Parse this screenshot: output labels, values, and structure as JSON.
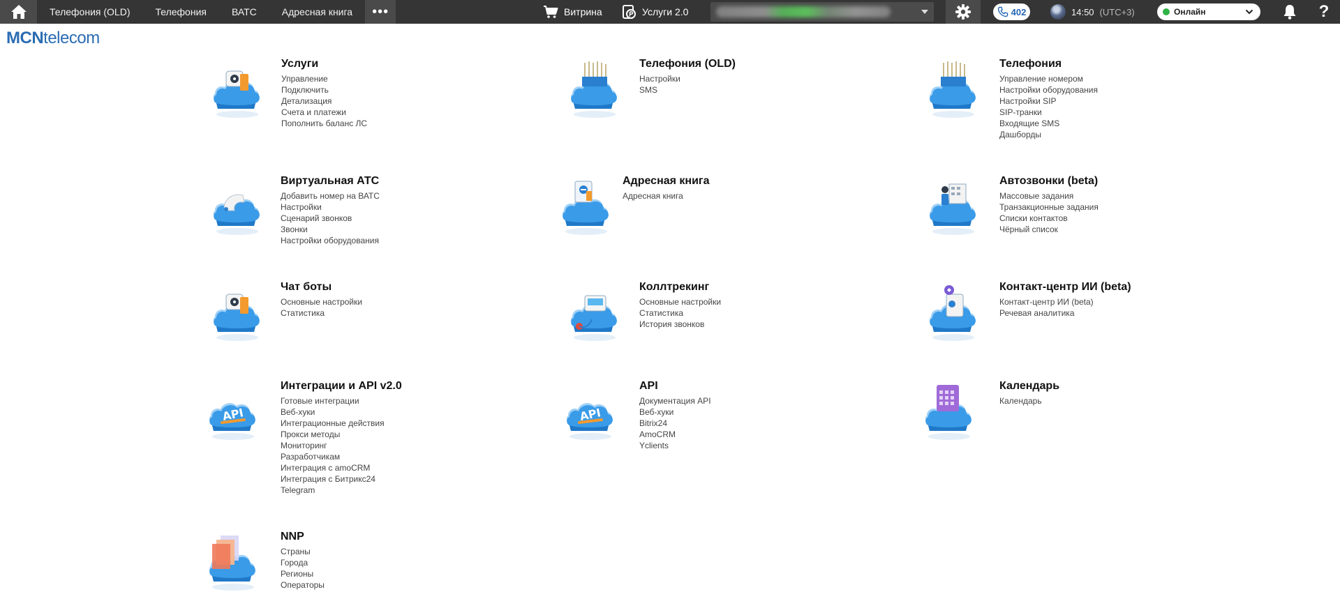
{
  "topbar": {
    "nav": [
      "Телефония (OLD)",
      "Телефония",
      "ВАТС",
      "Адресная книга"
    ],
    "more": "•••",
    "shop": "Витрина",
    "services": "Услуги 2.0",
    "phone_count": "402",
    "time": "14:50",
    "timezone": "(UTC+3)",
    "status": "Онлайн",
    "help": "?"
  },
  "logo": {
    "bold": "MCN",
    "rest": "telecom"
  },
  "tiles": [
    {
      "title": "Услуги",
      "icon": "services-cloud-icon",
      "links": [
        "Управление",
        "Подключить",
        "Детализация",
        "Счета и платежи",
        "Пополнить баланс ЛС"
      ]
    },
    {
      "title": "Телефония (OLD)",
      "icon": "telephony-old-cloud-icon",
      "links": [
        "Настройки",
        "SMS"
      ]
    },
    {
      "title": "Телефония",
      "icon": "telephony-cloud-icon",
      "links": [
        "Управление номером",
        "Настройки оборудования",
        "Настройки SIP",
        "SIP-транки",
        "Входящие SMS",
        "Дашборды"
      ]
    },
    {
      "title": "Виртуальная АТС",
      "icon": "pbx-cloud-icon",
      "links": [
        "Добавить номер на ВАТС",
        "Настройки",
        "Сценарий звонков",
        "Звонки",
        "Настройки оборудования"
      ]
    },
    {
      "title": "Адресная книга",
      "icon": "address-book-cloud-icon",
      "links": [
        "Адресная книга"
      ]
    },
    {
      "title": "Автозвонки (beta)",
      "icon": "autocall-cloud-icon",
      "links": [
        "Массовые задания",
        "Транзакционные задания",
        "Списки контактов",
        "Чёрный список"
      ]
    },
    {
      "title": "Чат боты",
      "icon": "chatbot-cloud-icon",
      "links": [
        "Основные настройки",
        "Статистика"
      ]
    },
    {
      "title": "Коллтрекинг",
      "icon": "calltracking-cloud-icon",
      "links": [
        "Основные настройки",
        "Статистика",
        "История звонков"
      ]
    },
    {
      "title": "Контакт-центр ИИ (beta)",
      "icon": "ai-contact-center-cloud-icon",
      "links": [
        "Контакт-центр ИИ (beta)",
        "Речевая аналитика"
      ]
    },
    {
      "title": "Интеграции и API v2.0",
      "icon": "api-v2-cloud-icon",
      "links": [
        "Готовые интеграции",
        "Веб-хуки",
        "Интеграционные действия",
        "Прокси методы",
        "Мониторинг",
        "Разработчикам",
        "Интеграция с amoCRM",
        "Интеграция с Битрикс24",
        "Telegram"
      ]
    },
    {
      "title": "API",
      "icon": "api-cloud-icon",
      "links": [
        "Документация API",
        "Веб-хуки",
        "Bitrix24",
        "AmoCRM",
        "Yclients"
      ]
    },
    {
      "title": "Календарь",
      "icon": "calendar-cloud-icon",
      "links": [
        "Календарь"
      ]
    },
    {
      "title": "NNP",
      "icon": "nnp-cloud-icon",
      "links": [
        "Страны",
        "Города",
        "Регионы",
        "Операторы"
      ]
    }
  ],
  "colors": {
    "topbar": "#353535",
    "accent": "#2a6cb3",
    "online": "#2fb344",
    "cloud": "#3a9be8"
  }
}
